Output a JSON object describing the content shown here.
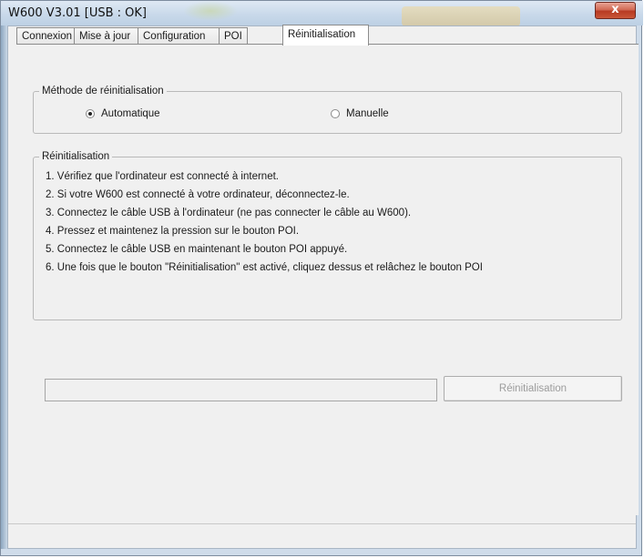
{
  "window": {
    "title": "W600 V3.01 [USB : OK]",
    "close_symbol": "x"
  },
  "tabs": [
    {
      "label": "Connexion"
    },
    {
      "label": "Mise à jour"
    },
    {
      "label": "Configuration"
    },
    {
      "label": "POI"
    },
    {
      "label": "Réinitialisation"
    }
  ],
  "active_tab": "Réinitialisation",
  "method_group": {
    "label": "Méthode de réinitialisation",
    "options": [
      {
        "label": "Automatique",
        "checked": true
      },
      {
        "label": "Manuelle",
        "checked": false
      }
    ]
  },
  "reset_group": {
    "label": "Réinitialisation",
    "steps": [
      "1. Vérifiez que l'ordinateur est connecté à internet.",
      "2. Si votre W600 est connecté à votre ordinateur, déconnectez-le.",
      "3. Connectez le câble USB à l'ordinateur (ne pas connecter le câble au W600).",
      "4. Pressez et maintenez la pression sur le bouton POI.",
      "5. Connectez le câble USB en maintenant le bouton POI appuyé.",
      "6. Une fois que le bouton  \"Réinitialisation\" est activé, cliquez dessus et relâchez le bouton POI"
    ]
  },
  "progress": {
    "value": 0
  },
  "reset_button": {
    "label": "Réinitialisation",
    "enabled": false
  },
  "colors": {
    "titlebar": "#c9d9ea",
    "close_button": "#c95638",
    "disabled_text": "#9c9c9c"
  }
}
